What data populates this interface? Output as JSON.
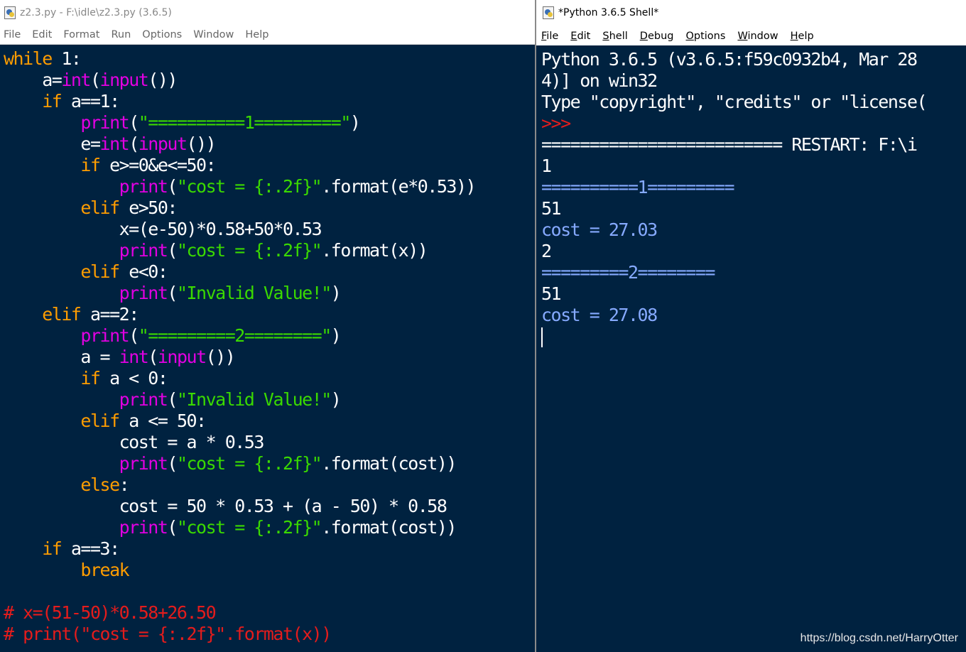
{
  "editor": {
    "title": "z2.3.py - F:\\idle\\z2.3.py (3.6.5)",
    "menu": [
      "File",
      "Edit",
      "Format",
      "Run",
      "Options",
      "Window",
      "Help"
    ],
    "code": [
      {
        "i": 0,
        "t": [
          [
            "kw",
            "while"
          ],
          [
            "",
            " 1:"
          ]
        ]
      },
      {
        "i": 1,
        "t": [
          [
            "",
            "a="
          ],
          [
            "bi",
            "int"
          ],
          [
            "",
            "("
          ],
          [
            "bi",
            "input"
          ],
          [
            "",
            "())"
          ]
        ]
      },
      {
        "i": 1,
        "t": [
          [
            "kw",
            "if"
          ],
          [
            "",
            " a==1:"
          ]
        ]
      },
      {
        "i": 2,
        "t": [
          [
            "bi",
            "print"
          ],
          [
            "",
            "("
          ],
          [
            "str",
            "\"==========1=========\""
          ],
          [
            "",
            ")"
          ]
        ]
      },
      {
        "i": 2,
        "t": [
          [
            "",
            "e="
          ],
          [
            "bi",
            "int"
          ],
          [
            "",
            "("
          ],
          [
            "bi",
            "input"
          ],
          [
            "",
            "())"
          ]
        ]
      },
      {
        "i": 2,
        "t": [
          [
            "kw",
            "if"
          ],
          [
            "",
            " e>=0&e<=50:"
          ]
        ]
      },
      {
        "i": 3,
        "t": [
          [
            "bi",
            "print"
          ],
          [
            "",
            "("
          ],
          [
            "str",
            "\"cost = {:.2f}\""
          ],
          [
            "",
            ".format(e*0.53))"
          ]
        ]
      },
      {
        "i": 2,
        "t": [
          [
            "kw",
            "elif"
          ],
          [
            "",
            " e>50:"
          ]
        ]
      },
      {
        "i": 3,
        "t": [
          [
            "",
            "x=(e-50)*0.58+50*0.53"
          ]
        ]
      },
      {
        "i": 3,
        "t": [
          [
            "bi",
            "print"
          ],
          [
            "",
            "("
          ],
          [
            "str",
            "\"cost = {:.2f}\""
          ],
          [
            "",
            ".format(x))"
          ]
        ]
      },
      {
        "i": 2,
        "t": [
          [
            "kw",
            "elif"
          ],
          [
            "",
            " e<0:"
          ]
        ]
      },
      {
        "i": 3,
        "t": [
          [
            "bi",
            "print"
          ],
          [
            "",
            "("
          ],
          [
            "str",
            "\"Invalid Value!\""
          ],
          [
            "",
            ")"
          ]
        ]
      },
      {
        "i": 1,
        "t": [
          [
            "kw",
            "elif"
          ],
          [
            "",
            " a==2:"
          ]
        ]
      },
      {
        "i": 2,
        "t": [
          [
            "bi",
            "print"
          ],
          [
            "",
            "("
          ],
          [
            "str",
            "\"=========2========\""
          ],
          [
            "",
            ")"
          ]
        ]
      },
      {
        "i": 2,
        "t": [
          [
            "",
            "a = "
          ],
          [
            "bi",
            "int"
          ],
          [
            "",
            "("
          ],
          [
            "bi",
            "input"
          ],
          [
            "",
            "())"
          ]
        ]
      },
      {
        "i": 2,
        "t": [
          [
            "kw",
            "if"
          ],
          [
            "",
            " a < 0:"
          ]
        ]
      },
      {
        "i": 3,
        "t": [
          [
            "bi",
            "print"
          ],
          [
            "",
            "("
          ],
          [
            "str",
            "\"Invalid Value!\""
          ],
          [
            "",
            ")"
          ]
        ]
      },
      {
        "i": 2,
        "t": [
          [
            "kw",
            "elif"
          ],
          [
            "",
            " a <= 50:"
          ]
        ]
      },
      {
        "i": 3,
        "t": [
          [
            "",
            "cost = a * 0.53"
          ]
        ]
      },
      {
        "i": 3,
        "t": [
          [
            "bi",
            "print"
          ],
          [
            "",
            "("
          ],
          [
            "str",
            "\"cost = {:.2f}\""
          ],
          [
            "",
            ".format(cost))"
          ]
        ]
      },
      {
        "i": 2,
        "t": [
          [
            "kw",
            "else"
          ],
          [
            "",
            ":"
          ]
        ]
      },
      {
        "i": 3,
        "t": [
          [
            "",
            "cost = 50 * 0.53 + (a - 50) * 0.58"
          ]
        ]
      },
      {
        "i": 3,
        "t": [
          [
            "bi",
            "print"
          ],
          [
            "",
            "("
          ],
          [
            "str",
            "\"cost = {:.2f}\""
          ],
          [
            "",
            ".format(cost))"
          ]
        ]
      },
      {
        "i": 1,
        "t": [
          [
            "kw",
            "if"
          ],
          [
            "",
            " a==3:"
          ]
        ]
      },
      {
        "i": 2,
        "t": [
          [
            "kw",
            "break"
          ]
        ]
      },
      {
        "i": 0,
        "t": []
      },
      {
        "i": 0,
        "t": [
          [
            "comment",
            "# x=(51-50)*0.58+26.50"
          ]
        ]
      },
      {
        "i": 0,
        "t": [
          [
            "comment",
            "# print(\"cost = {:.2f}\".format(x))"
          ]
        ]
      }
    ]
  },
  "shell": {
    "title": "*Python 3.6.5 Shell*",
    "menu": [
      "File",
      "Edit",
      "Shell",
      "Debug",
      "Options",
      "Window",
      "Help"
    ],
    "lines": [
      [
        [
          "",
          "Python 3.6.5 (v3.6.5:f59c0932b4, Mar 28"
        ]
      ],
      [
        [
          "",
          "4)] on win32"
        ]
      ],
      [
        [
          "",
          "Type \"copyright\", \"credits\" or \"license("
        ]
      ],
      [
        [
          "prompt",
          ">>>"
        ]
      ],
      [
        [
          "restart",
          "========================= RESTART: F:\\i"
        ]
      ],
      [
        [
          "input",
          "1"
        ]
      ],
      [
        [
          "stdout",
          "==========1========="
        ]
      ],
      [
        [
          "input",
          "51"
        ]
      ],
      [
        [
          "stdout",
          "cost = 27.03"
        ]
      ],
      [
        [
          "input",
          "2"
        ]
      ],
      [
        [
          "stdout",
          "=========2========"
        ]
      ],
      [
        [
          "input",
          "51"
        ]
      ],
      [
        [
          "stdout",
          "cost = 27.08"
        ]
      ]
    ]
  },
  "watermark": "https://blog.csdn.net/HarryOtter",
  "colors": {
    "background": "#002240",
    "keyword": "#ff9d00",
    "builtin": "#e200e2",
    "string": "#3ad900",
    "comment": "#e41c1c",
    "stdout": "#86aaff",
    "prompt": "#e41c1c"
  }
}
